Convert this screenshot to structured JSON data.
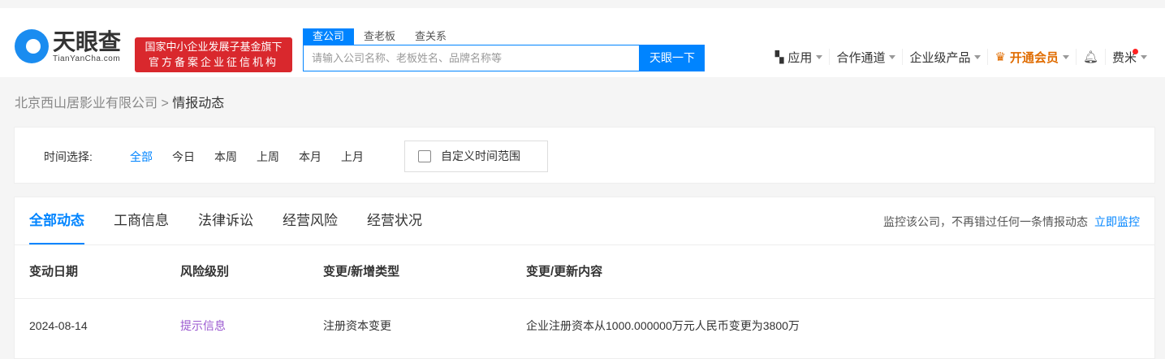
{
  "header": {
    "logo_cn": "天眼查",
    "logo_en": "TianYanCha.com",
    "badge_line1": "国家中小企业发展子基金旗下",
    "badge_line2": "官方备案企业征信机构",
    "search_tabs": [
      "查公司",
      "查老板",
      "查关系"
    ],
    "search_placeholder": "请输入公司名称、老板姓名、品牌名称等",
    "search_button": "天眼一下",
    "nav": {
      "apps": "应用",
      "channel": "合作通道",
      "enterprise": "企业级产品",
      "vip": "开通会员",
      "user": "费米"
    }
  },
  "breadcrumb": {
    "company": "北京西山居影业有限公司",
    "separator": ">",
    "current": "情报动态"
  },
  "filter": {
    "label": "时间选择:",
    "options": [
      "全部",
      "今日",
      "本周",
      "上周",
      "本月",
      "上月"
    ],
    "custom": "自定义时间范围"
  },
  "tabs": [
    "全部动态",
    "工商信息",
    "法律诉讼",
    "经营风险",
    "经营状况"
  ],
  "monitor": {
    "text": "监控该公司，不再错过任何一条情报动态",
    "link": "立即监控"
  },
  "table": {
    "headers": [
      "变动日期",
      "风险级别",
      "变更/新增类型",
      "变更/更新内容"
    ],
    "rows": [
      {
        "date": "2024-08-14",
        "risk": "提示信息",
        "type": "注册资本变更",
        "content": "企业注册资本从1000.000000万元人民币变更为3800万"
      }
    ]
  }
}
